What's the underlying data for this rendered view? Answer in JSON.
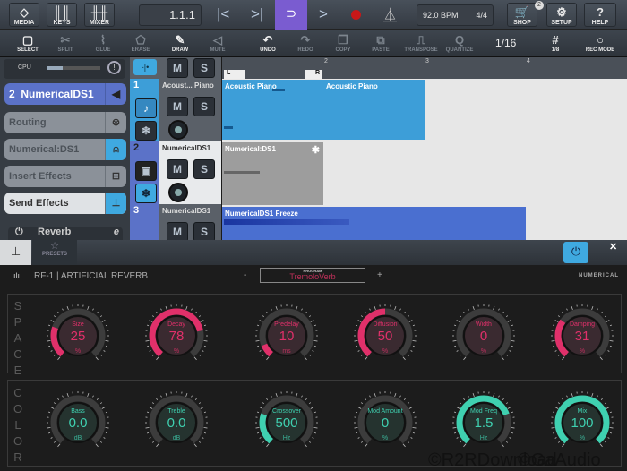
{
  "toolbar": {
    "media": "MEDIA",
    "keys": "KEYS",
    "mixer": "MIXER",
    "position": "1.1.1",
    "tempo": "92.0 BPM",
    "signature": "4/4",
    "shop": "SHOP",
    "shop_badge": "2",
    "setup": "SETUP",
    "help": "HELP",
    "accent": "#7a5cd0"
  },
  "edit_toolbar": {
    "items": [
      {
        "label": "SELECT",
        "icon": "select-icon",
        "active": true
      },
      {
        "label": "SPLIT",
        "icon": "scissors-icon",
        "active": false
      },
      {
        "label": "GLUE",
        "icon": "glue-icon",
        "active": false
      },
      {
        "label": "ERASE",
        "icon": "eraser-icon",
        "active": false
      },
      {
        "label": "DRAW",
        "icon": "pencil-icon",
        "active": true
      },
      {
        "label": "MUTE",
        "icon": "speaker-icon",
        "active": false
      },
      {
        "label": "UNDO",
        "icon": "undo-icon",
        "active": true
      },
      {
        "label": "REDO",
        "icon": "redo-icon",
        "active": false
      },
      {
        "label": "COPY",
        "icon": "copy-icon",
        "active": false
      },
      {
        "label": "PASTE",
        "icon": "paste-icon",
        "active": false
      },
      {
        "label": "TRANSPOSE",
        "icon": "transpose-icon",
        "active": false
      },
      {
        "label": "QUANTIZE",
        "icon": "q-icon",
        "active": false
      }
    ],
    "quantize_value": "1/16",
    "grid_label": "1/8",
    "rec_mode": "REC MODE"
  },
  "inspector": {
    "cpu_label": "CPU",
    "cpu_load": 0.3,
    "track_number": "2",
    "track_name": "NumericalDS1",
    "routing": "Routing",
    "instrument": "Numerical:DS1",
    "insert_effects": "Insert Effects",
    "send_effects": "Send Effects",
    "reverb": "Reverb"
  },
  "tracks": [
    {
      "number": "1",
      "name": "Acoust... Piano",
      "clip": "Acoustic Piano",
      "clip2": "Acoustic Piano"
    },
    {
      "number": "2",
      "name": "NumericalDS1",
      "clip": "Numerical:DS1"
    },
    {
      "number": "3",
      "name": "NumericalDS1",
      "clip": "NumericalDS1 Freeze"
    }
  ],
  "ruler": {
    "marks": [
      "2",
      "3",
      "4"
    ],
    "left_locator": "L",
    "right_locator": "R"
  },
  "plugin_panel": {
    "presets": "PRESETS",
    "title": "RF-1 | ARTIFICIAL REVERB",
    "program_label": "PROGRAM",
    "program": "TremoloVerb",
    "minus": "-",
    "plus": "+",
    "brand": "NUMERICAL",
    "space_label": "SPACE",
    "color_label": "COLOR",
    "space": [
      {
        "name": "Size",
        "value": "25",
        "unit": "%",
        "level": 0.25
      },
      {
        "name": "Decay",
        "value": "78",
        "unit": "%",
        "level": 0.78
      },
      {
        "name": "Predelay",
        "value": "10",
        "unit": "ms",
        "level": 0.1
      },
      {
        "name": "Diffusion",
        "value": "50",
        "unit": "%",
        "level": 0.5
      },
      {
        "name": "Width",
        "value": "0",
        "unit": "%",
        "level": 0
      },
      {
        "name": "Damping",
        "value": "31",
        "unit": "%",
        "level": 0.31
      }
    ],
    "color": [
      {
        "name": "Bass",
        "value": "0.0",
        "unit": "dB",
        "level": 0
      },
      {
        "name": "Treble",
        "value": "0.0",
        "unit": "dB",
        "level": 0
      },
      {
        "name": "Crossover",
        "value": "500",
        "unit": "Hz",
        "level": 0.25
      },
      {
        "name": "Mod Amount",
        "value": "0",
        "unit": "%",
        "level": 0
      },
      {
        "name": "Mod Freq",
        "value": "1.5",
        "unit": "Hz",
        "level": 0.75
      },
      {
        "name": "Mix",
        "value": "100",
        "unit": "%",
        "level": 1
      }
    ],
    "space_color": "#e0306a",
    "color_color": "#3fd0b0"
  },
  "watermark": [
    "©R2RDownload",
    "©GaAudio"
  ]
}
